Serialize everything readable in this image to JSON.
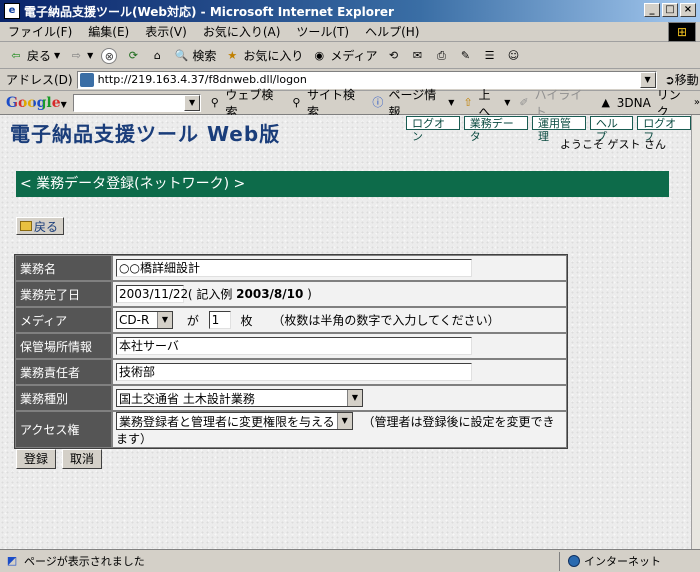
{
  "window": {
    "title": "電子納品支援ツール(Web対応) - Microsoft Internet Explorer",
    "app_icon": "e",
    "min": "_",
    "max": "□",
    "close": "×"
  },
  "menu": [
    "ファイル(F)",
    "編集(E)",
    "表示(V)",
    "お気に入り(A)",
    "ツール(T)",
    "ヘルプ(H)"
  ],
  "toolbar": {
    "back": "戻る",
    "search": "検索",
    "favorites": "お気に入り",
    "media": "メディア"
  },
  "address": {
    "label": "アドレス(D)",
    "url": "http://219.163.4.37/f8dnweb.dll/logon",
    "go": "移動"
  },
  "google": {
    "logo": "Google",
    "web_search": "ウェブ検索",
    "site_search": "サイト検索",
    "page_info": "ページ情報",
    "up": "上へ",
    "highlight": "ハイライト",
    "dna": "3DNA",
    "links": "リンク"
  },
  "app": {
    "title": "電子納品支援ツール Web版",
    "nav": [
      "ログオン",
      "業務データ",
      "運用管理",
      "ヘルプ",
      "ログオフ"
    ],
    "welcome": "ようこそ  ゲスト さん",
    "banner": "< 業務データ登録(ネットワーク) >",
    "back": "戻る"
  },
  "form": {
    "labels": [
      "業務名",
      "業務完了日",
      "メディア",
      "保管場所情報",
      "業務責任者",
      "業務種別",
      "アクセス権"
    ],
    "project_name": "○○橋詳細設計",
    "completion_date": "2003/11/22",
    "date_note_prefix": "( 記入例 ",
    "date_example": "2003/8/10",
    "date_note_suffix": " )",
    "media_type": "CD-R",
    "media_ga": "が",
    "media_count": "1",
    "media_unit": "枚",
    "media_note": "（枚数は半角の数字で入力してください）",
    "storage": "本社サーバ",
    "manager": "技術部",
    "category": "国土交通省  土木設計業務",
    "access": "業務登録者と管理者に変更権限を与える",
    "access_note": "（管理者は登録後に設定を変更できます）"
  },
  "buttons": {
    "register": "登録",
    "cancel": "取消"
  },
  "status": {
    "text": "ページが表示されました",
    "zone": "インターネット"
  }
}
